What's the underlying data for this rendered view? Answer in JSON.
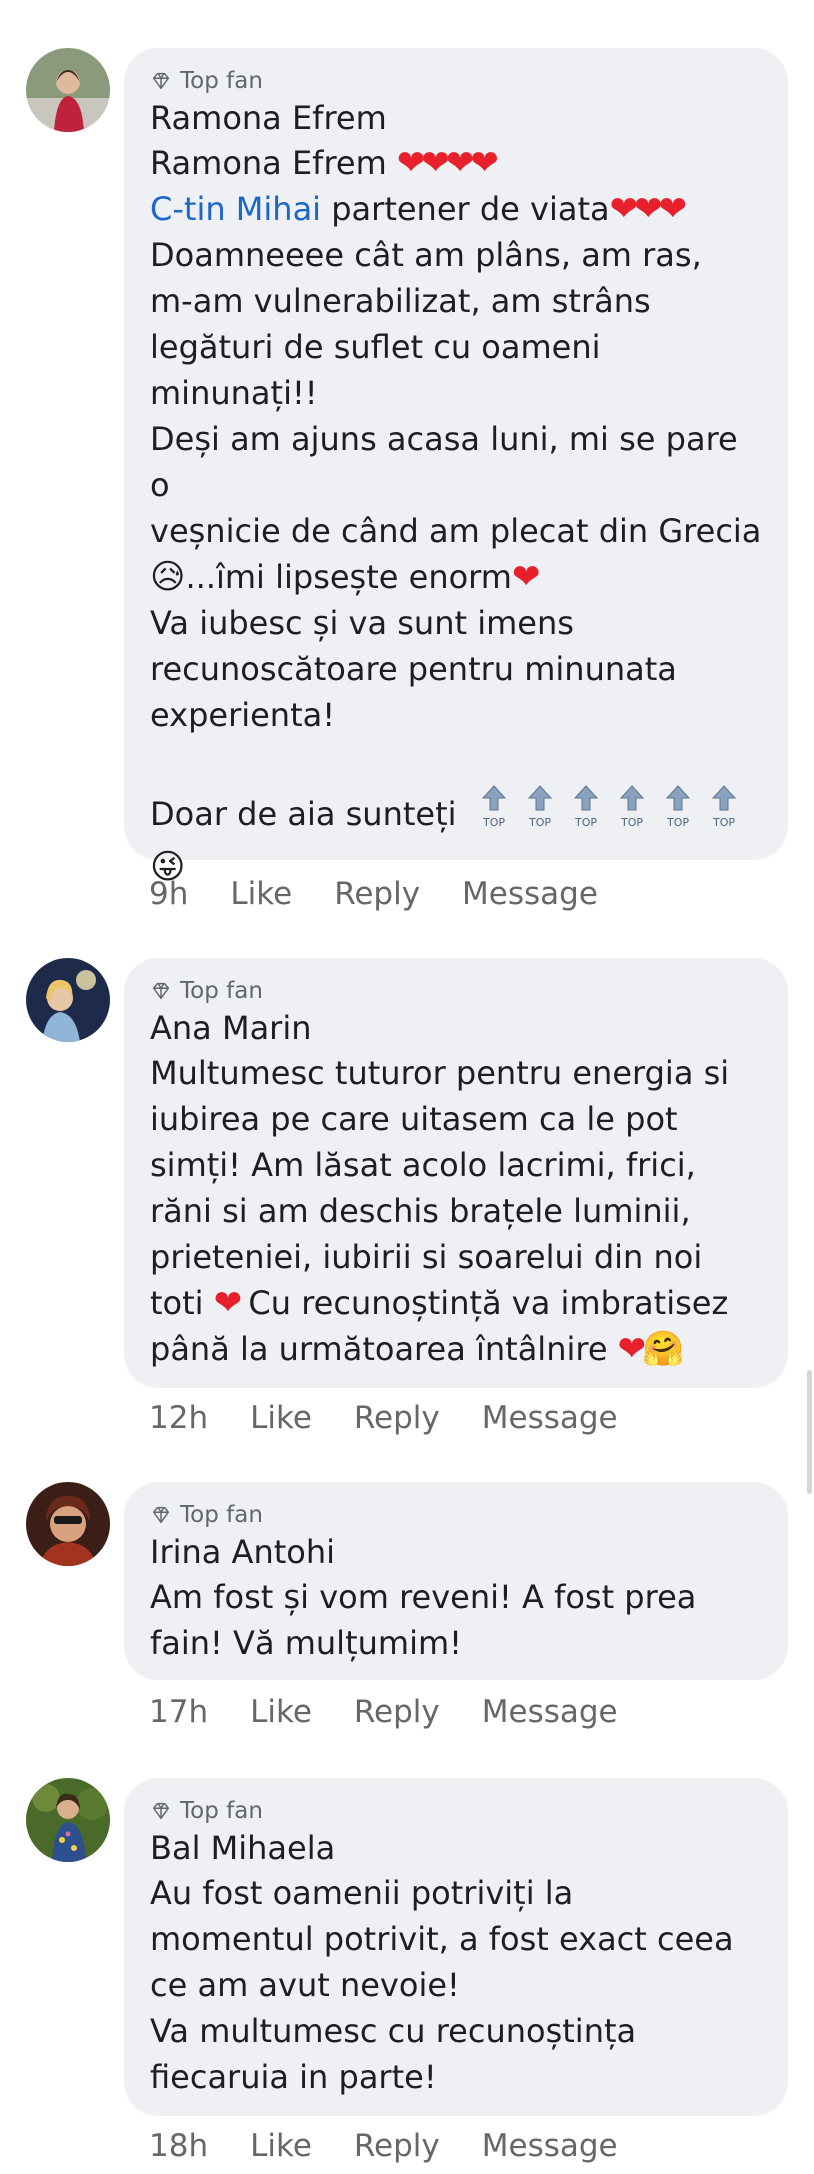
{
  "comments": [
    {
      "badge": "Top fan",
      "author": "Ramona Efrem",
      "lines": {
        "l1_name": "Ramona Efrem",
        "l2_mention": "C-tin Mihai",
        "l2_rest": " partener de viata",
        "l3": " Doamneeee cât am plâns, am ras,",
        "l4": "m-am vulnerabilizat, am strâns",
        "l5": "legături de suflet cu oameni",
        "l6": "minunați!!",
        "l7": "Deși am ajuns acasa luni, mi se pare o",
        "l8": "veșnicie de când am plecat din Grecia",
        "l9": "...îmi lipsește enorm",
        "l10": "Va iubesc și va sunt imens",
        "l11": "recunoscătoare pentru minunata",
        "l12": "experienta!",
        "l13": "Doar de aia sunteți",
        "top_label": "TOP"
      },
      "time": "9h",
      "like": "Like",
      "reply": "Reply",
      "message": "Message"
    },
    {
      "badge": "Top fan",
      "author": "Ana Marin",
      "lines": {
        "l1": "Multumesc tuturor pentru energia si",
        "l2": "iubirea pe care uitasem ca le pot",
        "l3": "simți! Am lăsat acolo lacrimi, frici,",
        "l4": "răni si am deschis brațele luminii,",
        "l5": "prieteniei, iubirii si soarelui din noi",
        "l6a": "toti ",
        "l6b": " Cu recunoștință va imbratisez",
        "l7": "până la următoarea întâlnire "
      },
      "time": "12h",
      "like": "Like",
      "reply": "Reply",
      "message": "Message"
    },
    {
      "badge": "Top fan",
      "author": "Irina Antohi",
      "lines": {
        "l1": "Am fost și vom reveni! A fost prea",
        "l2": "fain! Vă mulțumim!"
      },
      "time": "17h",
      "like": "Like",
      "reply": "Reply",
      "message": "Message"
    },
    {
      "badge": "Top fan",
      "author": "Bal Mihaela",
      "lines": {
        "l1": "Au fost oamenii potriviți la",
        "l2": "momentul potrivit, a fost exact ceea",
        "l3": "ce am avut nevoie!",
        "l4": "Va multumesc cu recunoștința",
        "l5": "fiecaruia in parte!"
      },
      "time": "18h",
      "like": "Like",
      "reply": "Reply",
      "message": "Message"
    }
  ],
  "emojis": {
    "heart": "❤",
    "sad": "😥",
    "tongue": "😜",
    "hug": "🤗"
  },
  "colors": {
    "bubble": "#eff0f3",
    "mention": "#1b66c9",
    "heart": "#e8202c",
    "meta": "#65676b"
  }
}
